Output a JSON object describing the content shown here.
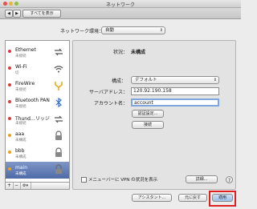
{
  "window": {
    "title": "ネットワーク"
  },
  "toolbar": {
    "back": "◀",
    "forward": "▶",
    "show_all": "すべてを表示"
  },
  "location": {
    "label": "ネットワーク環境：",
    "value": "自動"
  },
  "services": [
    {
      "name": "Ethernet",
      "status": "未接続",
      "color": "#d83a3a",
      "icon": "ethernet-icon"
    },
    {
      "name": "Wi-Fi",
      "status": "切",
      "color": "#d83a3a",
      "icon": "wifi-icon"
    },
    {
      "name": "FireWire",
      "status": "未接続",
      "color": "#d83a3a",
      "icon": "firewire-icon"
    },
    {
      "name": "Bluetooth PAN",
      "status": "未接続",
      "color": "#d83a3a",
      "icon": "bluetooth-icon"
    },
    {
      "name": "Thund…リッジ",
      "status": "未接続",
      "color": "#d83a3a",
      "icon": "thunderbolt-bridge-icon"
    },
    {
      "name": "aaa",
      "status": "未構成",
      "color": "#e8a21b",
      "icon": "vpn-lock-icon"
    },
    {
      "name": "bbb",
      "status": "未構成",
      "color": "#e8a21b",
      "icon": "vpn-lock-icon"
    },
    {
      "name": "main",
      "status": "未構成",
      "color": "#e8a21b",
      "icon": "vpn-lock-icon"
    }
  ],
  "sidebar_buttons": {
    "add": "+",
    "remove": "−",
    "gear": "⚙▾"
  },
  "detail": {
    "status_label": "状況：",
    "status_value": "未構成",
    "config_label": "構成：",
    "config_value": "デフォルト",
    "server_label": "サーバアドレス：",
    "server_value": "120.92.190.158",
    "account_label": "アカウント名：",
    "account_value": "account",
    "auth_button": "認証設定...",
    "connect_button": "接続",
    "menubar_checkbox": "メニューバーに VPN の状況を表示",
    "advanced_button": "詳細...",
    "help": "?"
  },
  "footer": {
    "assistant": "アシスタント...",
    "revert": "元に戻す",
    "apply": "適用"
  }
}
